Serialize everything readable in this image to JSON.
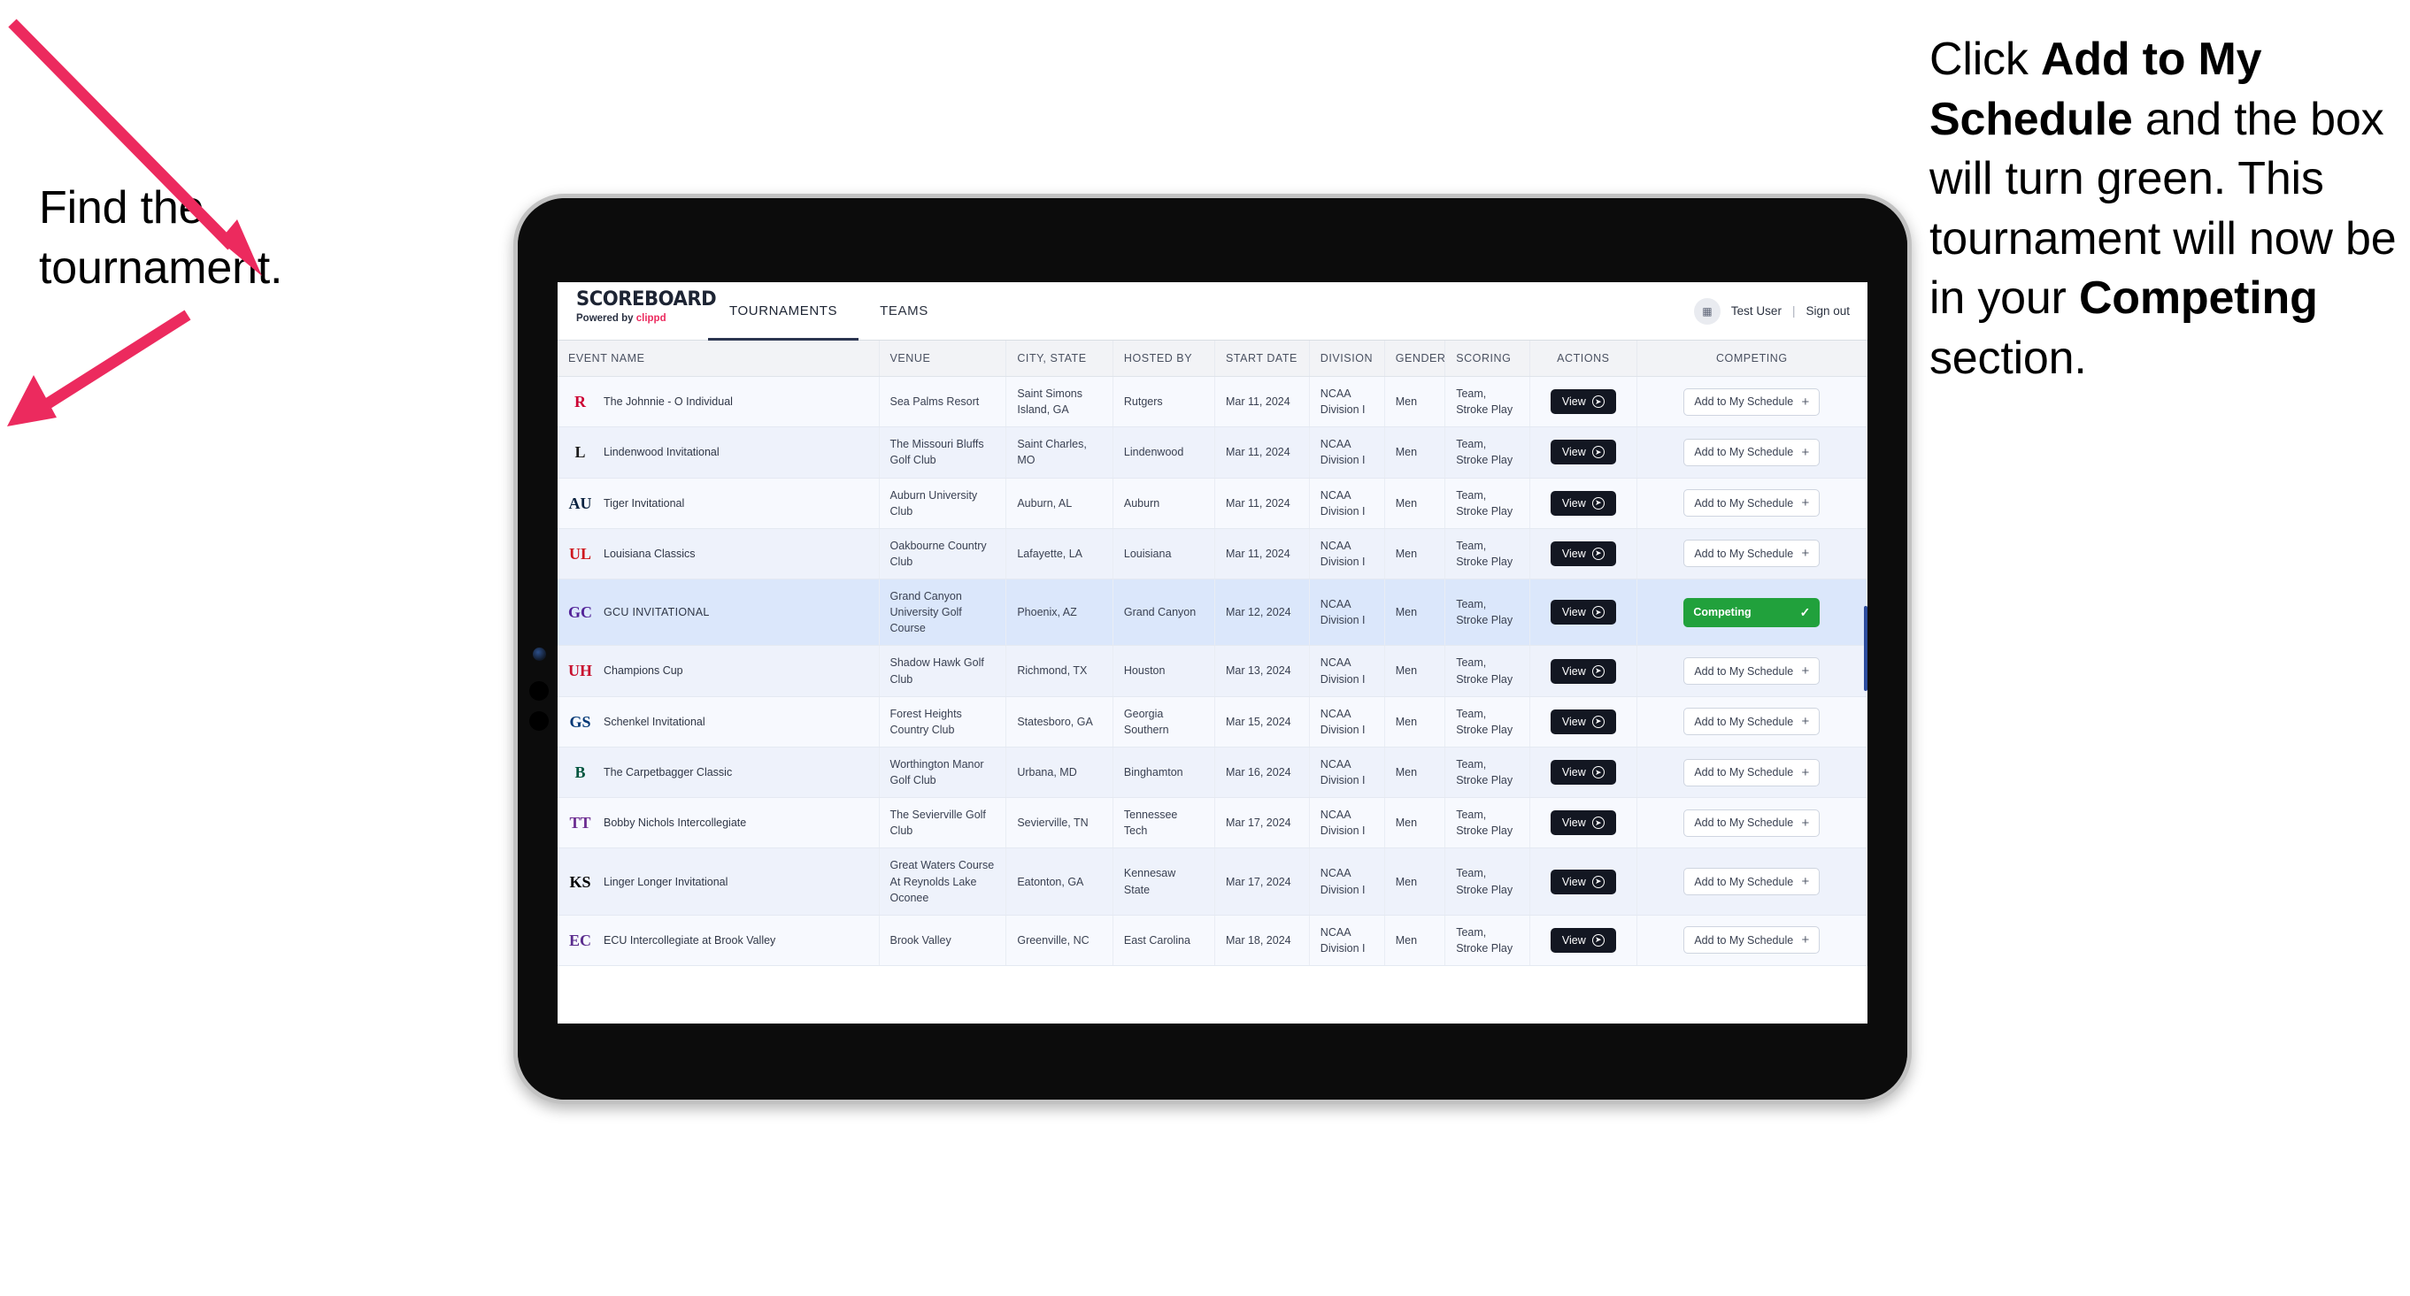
{
  "annotations": {
    "left": {
      "line1": "Find the",
      "line2": "tournament."
    },
    "right": {
      "p1_pre": "Click ",
      "p1_bold": "Add to My Schedule",
      "p1_post": " and the box will turn green. This tournament will now be in your ",
      "p2_bold": "Competing",
      "p2_post": " section."
    },
    "arrow_color": "#ec2a5e"
  },
  "app": {
    "brand": {
      "title": "SCOREBOARD",
      "powered_pre": "Powered by ",
      "powered_brand": "clippd"
    },
    "nav_tabs": [
      {
        "label": "TOURNAMENTS",
        "active": true
      },
      {
        "label": "TEAMS",
        "active": false
      }
    ],
    "user": {
      "avatar_icon": "user-avatar-icon",
      "name": "Test User",
      "separator": "|",
      "signout": "Sign out"
    }
  },
  "table": {
    "columns": [
      "EVENT NAME",
      "VENUE",
      "CITY, STATE",
      "HOSTED BY",
      "START DATE",
      "DIVISION",
      "GENDER",
      "SCORING",
      "ACTIONS",
      "COMPETING"
    ],
    "buttons": {
      "view": "View",
      "view_icon": "arrow-right-circle-icon",
      "add": "Add to My Schedule",
      "add_icon": "plus-icon",
      "competing": "Competing",
      "competing_icon": "check-icon"
    },
    "rows": [
      {
        "logo_text": "R",
        "logo_color": "#cc0033",
        "logo_name": "rutgers-logo",
        "event": "The Johnnie - O Individual",
        "caps": false,
        "venue": "Sea Palms Resort",
        "city": "Saint Simons Island, GA",
        "hosted_by": "Rutgers",
        "start_date": "Mar 11, 2024",
        "division": "NCAA Division I",
        "gender": "Men",
        "scoring": "Team, Stroke Play",
        "competing": false
      },
      {
        "logo_text": "L",
        "logo_color": "#1c1c1c",
        "logo_name": "lindenwood-logo",
        "event": "Lindenwood Invitational",
        "caps": false,
        "venue": "The Missouri Bluffs Golf Club",
        "city": "Saint Charles, MO",
        "hosted_by": "Lindenwood",
        "start_date": "Mar 11, 2024",
        "division": "NCAA Division I",
        "gender": "Men",
        "scoring": "Team, Stroke Play",
        "competing": false
      },
      {
        "logo_text": "AU",
        "logo_color": "#0c2340",
        "logo_name": "auburn-logo",
        "event": "Tiger Invitational",
        "caps": false,
        "venue": "Auburn University Club",
        "city": "Auburn, AL",
        "hosted_by": "Auburn",
        "start_date": "Mar 11, 2024",
        "division": "NCAA Division I",
        "gender": "Men",
        "scoring": "Team, Stroke Play",
        "competing": false
      },
      {
        "logo_text": "UL",
        "logo_color": "#ce181e",
        "logo_name": "louisiana-logo",
        "event": "Louisiana Classics",
        "caps": false,
        "venue": "Oakbourne Country Club",
        "city": "Lafayette, LA",
        "hosted_by": "Louisiana",
        "start_date": "Mar 11, 2024",
        "division": "NCAA Division I",
        "gender": "Men",
        "scoring": "Team, Stroke Play",
        "competing": false
      },
      {
        "logo_text": "GC",
        "logo_color": "#522398",
        "logo_name": "grand-canyon-logo",
        "event": "GCU INVITATIONAL",
        "caps": true,
        "venue": "Grand Canyon University Golf Course",
        "city": "Phoenix, AZ",
        "hosted_by": "Grand Canyon",
        "start_date": "Mar 12, 2024",
        "division": "NCAA Division I",
        "gender": "Men",
        "scoring": "Team, Stroke Play",
        "competing": true
      },
      {
        "logo_text": "UH",
        "logo_color": "#c8102e",
        "logo_name": "houston-logo",
        "event": "Champions Cup",
        "caps": false,
        "venue": "Shadow Hawk Golf Club",
        "city": "Richmond, TX",
        "hosted_by": "Houston",
        "start_date": "Mar 13, 2024",
        "division": "NCAA Division I",
        "gender": "Men",
        "scoring": "Team, Stroke Play",
        "competing": false
      },
      {
        "logo_text": "GS",
        "logo_color": "#003775",
        "logo_name": "georgia-southern-logo",
        "event": "Schenkel Invitational",
        "caps": false,
        "venue": "Forest Heights Country Club",
        "city": "Statesboro, GA",
        "hosted_by": "Georgia Southern",
        "start_date": "Mar 15, 2024",
        "division": "NCAA Division I",
        "gender": "Men",
        "scoring": "Team, Stroke Play",
        "competing": false
      },
      {
        "logo_text": "B",
        "logo_color": "#00553e",
        "logo_name": "binghamton-logo",
        "event": "The Carpetbagger Classic",
        "caps": false,
        "venue": "Worthington Manor Golf Club",
        "city": "Urbana, MD",
        "hosted_by": "Binghamton",
        "start_date": "Mar 16, 2024",
        "division": "NCAA Division I",
        "gender": "Men",
        "scoring": "Team, Stroke Play",
        "competing": false
      },
      {
        "logo_text": "TT",
        "logo_color": "#6b2c91",
        "logo_name": "tennessee-tech-logo",
        "event": "Bobby Nichols Intercollegiate",
        "caps": false,
        "venue": "The Sevierville Golf Club",
        "city": "Sevierville, TN",
        "hosted_by": "Tennessee Tech",
        "start_date": "Mar 17, 2024",
        "division": "NCAA Division I",
        "gender": "Men",
        "scoring": "Team, Stroke Play",
        "competing": false
      },
      {
        "logo_text": "KS",
        "logo_color": "#000000",
        "logo_name": "kennesaw-state-logo",
        "event": "Linger Longer Invitational",
        "caps": false,
        "venue": "Great Waters Course At Reynolds Lake Oconee",
        "city": "Eatonton, GA",
        "hosted_by": "Kennesaw State",
        "start_date": "Mar 17, 2024",
        "division": "NCAA Division I",
        "gender": "Men",
        "scoring": "Team, Stroke Play",
        "competing": false
      },
      {
        "logo_text": "EC",
        "logo_color": "#5b2d8e",
        "logo_name": "east-carolina-logo",
        "event": "ECU Intercollegiate at Brook Valley",
        "caps": false,
        "venue": "Brook Valley",
        "city": "Greenville, NC",
        "hosted_by": "East Carolina",
        "start_date": "Mar 18, 2024",
        "division": "NCAA Division I",
        "gender": "Men",
        "scoring": "Team, Stroke Play",
        "competing": false
      }
    ]
  }
}
